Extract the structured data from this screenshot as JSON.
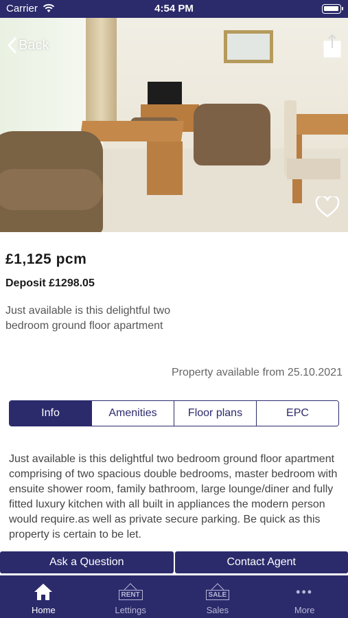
{
  "status_bar": {
    "carrier": "Carrier",
    "time": "4:54 PM"
  },
  "nav": {
    "back_label": "Back"
  },
  "listing": {
    "price": "£1,125 pcm",
    "deposit": "Deposit £1298.05",
    "summary": "Just available is this delightful two bedroom ground floor apartment",
    "availability": "Property available from 25.10.2021",
    "description": "Just available is this delightful two bedroom ground floor apartment comprising of two spacious double bedrooms, master bedroom with ensuite shower room, family bathroom, large lounge/diner and fully fitted luxury kitchen with all built in appliances the modern person would require.as well as private secure parking. Be quick as this property is certain to be let."
  },
  "tabs": [
    {
      "label": "Info",
      "active": true
    },
    {
      "label": "Amenities",
      "active": false
    },
    {
      "label": "Floor plans",
      "active": false
    },
    {
      "label": "EPC",
      "active": false
    }
  ],
  "actions": {
    "ask_question": "Ask a Question",
    "contact_agent": "Contact Agent"
  },
  "tab_bar": {
    "items": [
      {
        "label": "Home",
        "icon": "home-icon"
      },
      {
        "label": "Lettings",
        "icon": "rent-sign-icon",
        "icon_text": "RENT"
      },
      {
        "label": "Sales",
        "icon": "sale-sign-icon",
        "icon_text": "SALE"
      },
      {
        "label": "More",
        "icon": "more-icon"
      }
    ]
  },
  "colors": {
    "brand": "#2b2a6b",
    "inactive_tab": "#b9b8d6"
  }
}
